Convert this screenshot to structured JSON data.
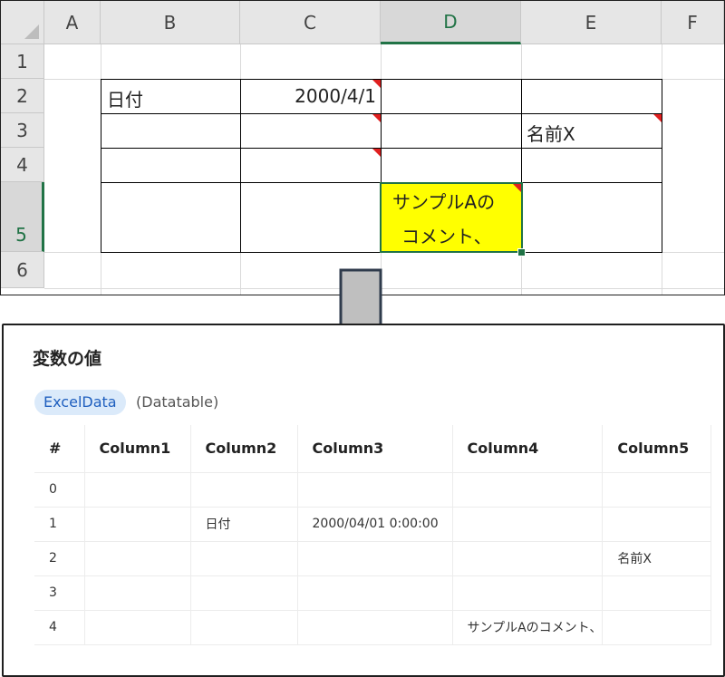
{
  "excel": {
    "columns": [
      "A",
      "B",
      "C",
      "D",
      "E",
      "F"
    ],
    "rows": [
      "1",
      "2",
      "3",
      "4",
      "5",
      "6"
    ],
    "cells": {
      "b2": "日付",
      "c2": "2000/4/1",
      "e3": "名前X",
      "d5_line1": "サンプルAの",
      "d5_line2": "コメント、"
    },
    "highlight_color": "#ffff00",
    "accent_color": "#217346",
    "comment_marker_color": "#e02020"
  },
  "arrow": {
    "icon": "down-arrow-icon",
    "fill": "#bfbfbf",
    "stroke": "#2f3b4c"
  },
  "variable_panel": {
    "title": "変数の値",
    "variable_name": "ExcelData",
    "variable_type": "(Datatable)",
    "table": {
      "headers": [
        "#",
        "Column1",
        "Column2",
        "Column3",
        "Column4",
        "Column5"
      ],
      "rows": [
        [
          "0",
          "",
          "",
          "",
          "",
          ""
        ],
        [
          "1",
          "",
          "日付",
          "2000/04/01 0:00:00",
          "",
          ""
        ],
        [
          "2",
          "",
          "",
          "",
          "",
          "名前X"
        ],
        [
          "3",
          "",
          "",
          "",
          "",
          ""
        ],
        [
          "4",
          "",
          "",
          "",
          "サンプルAのコメント、",
          ""
        ]
      ]
    }
  }
}
